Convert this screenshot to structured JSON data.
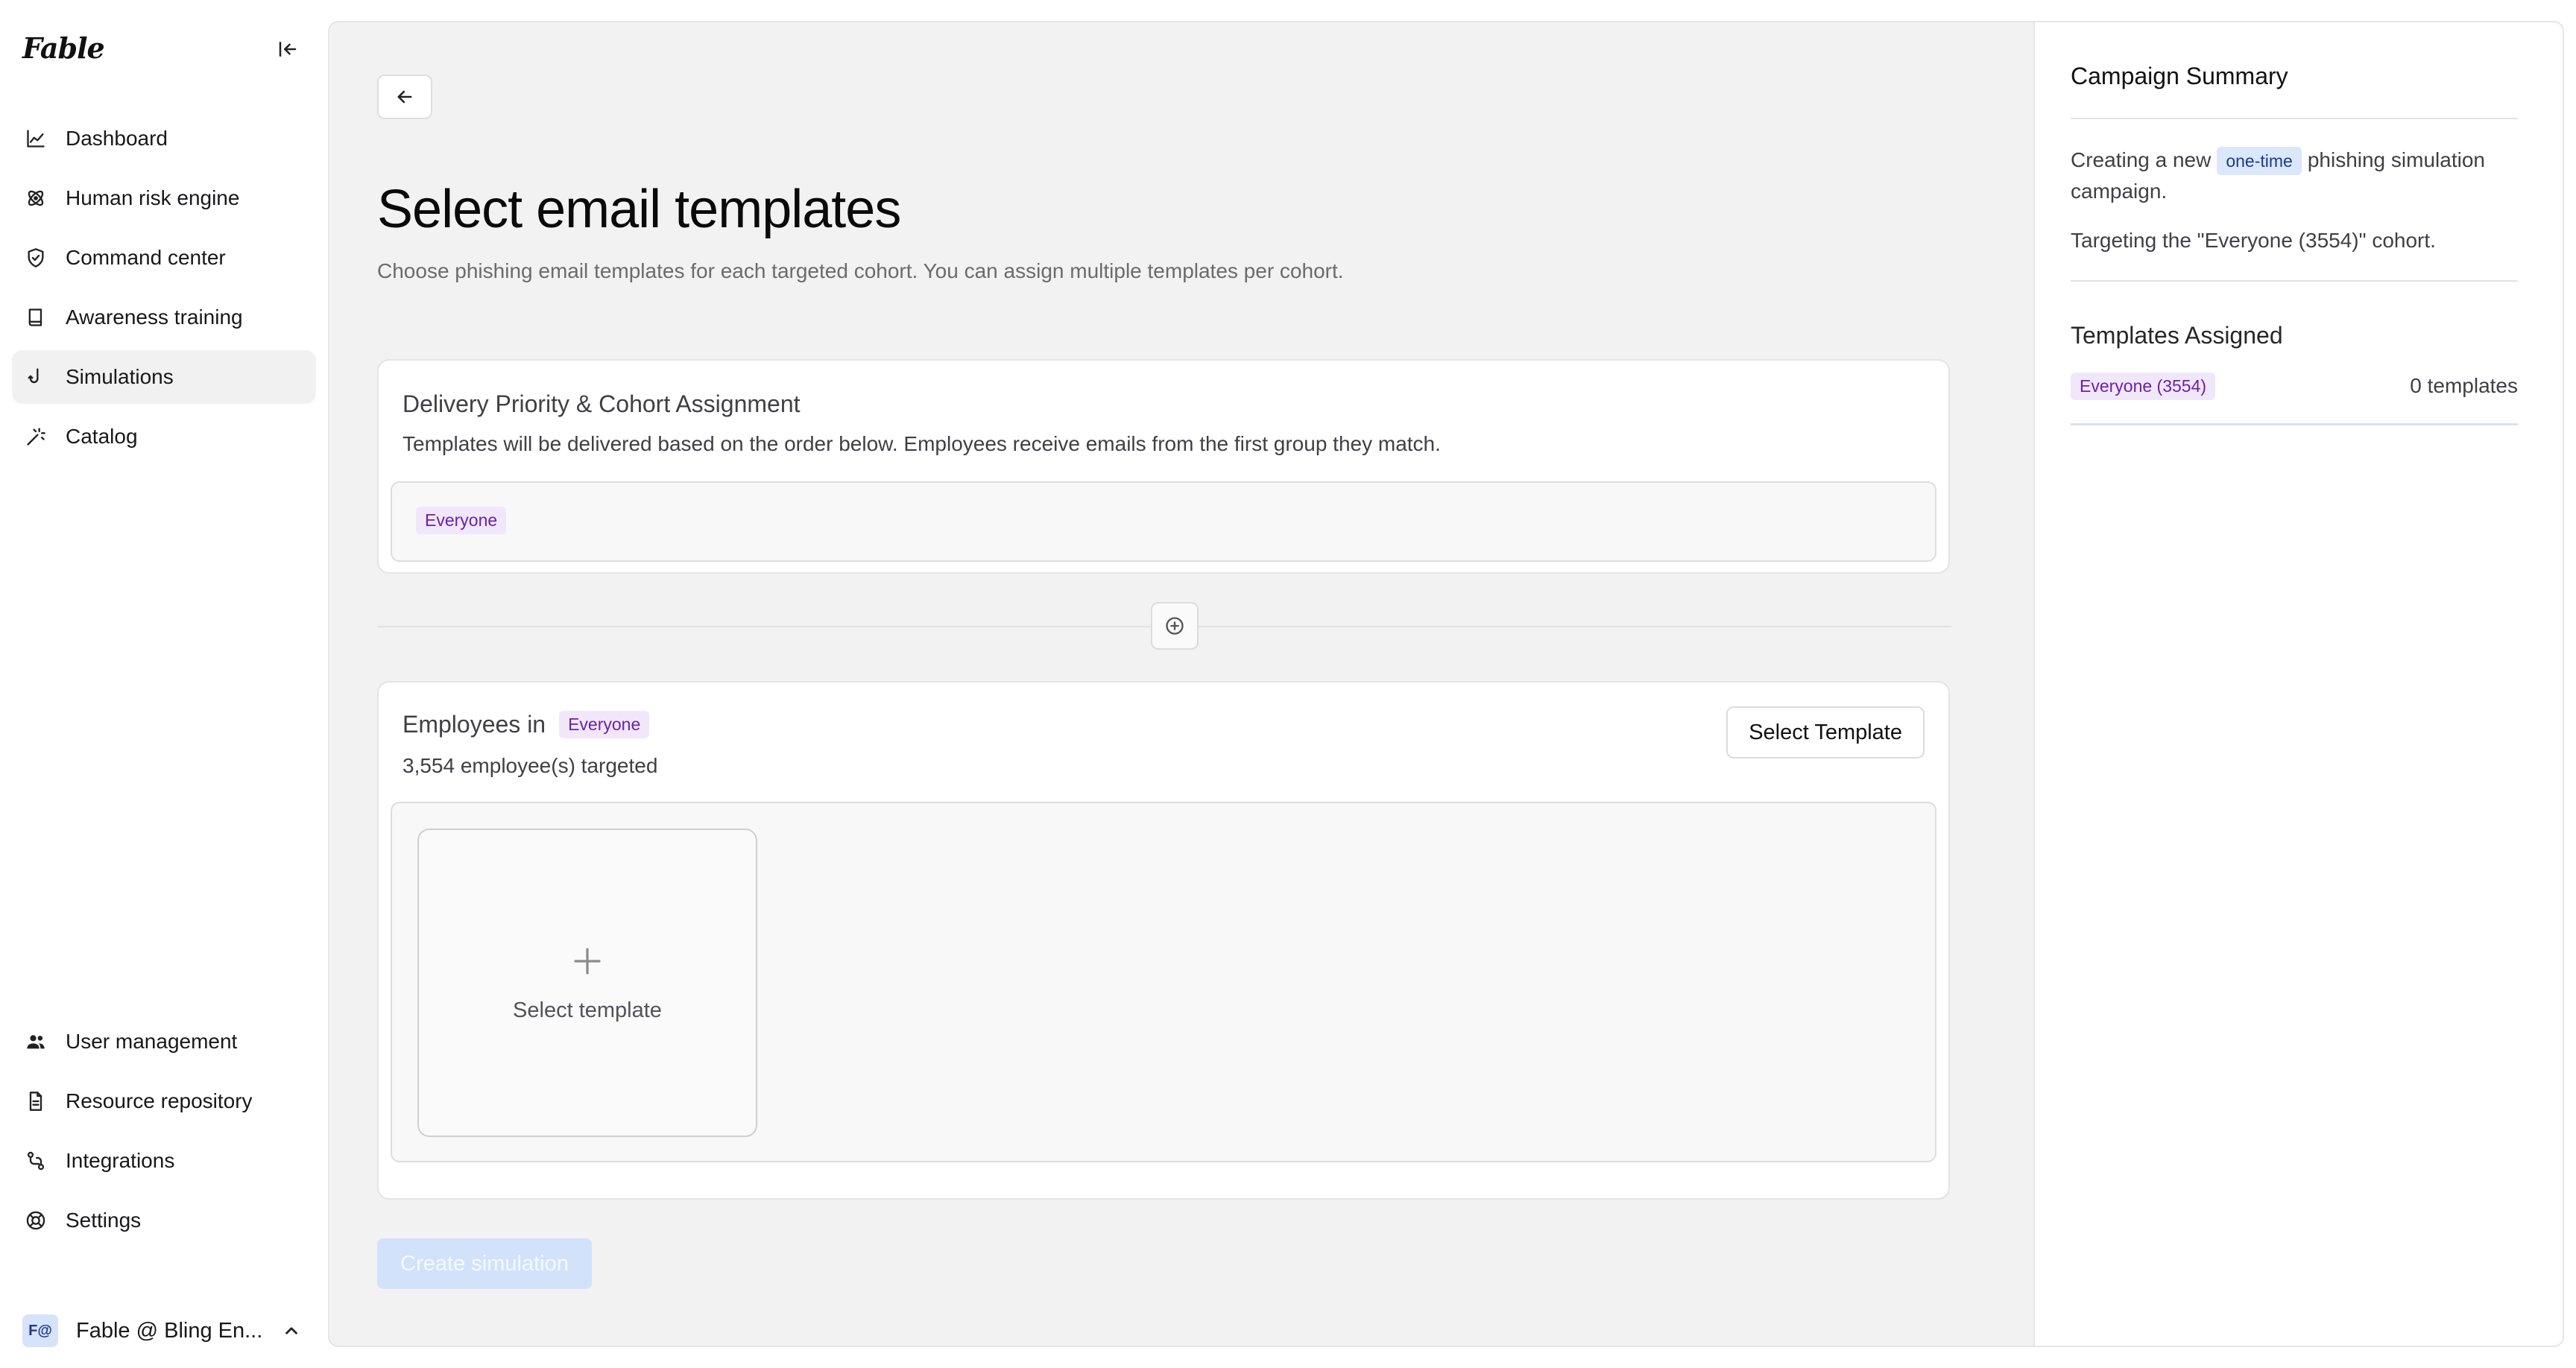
{
  "sidebar": {
    "logo": "Fable",
    "nav": [
      {
        "label": "Dashboard",
        "icon": "chart-line-icon"
      },
      {
        "label": "Human risk engine",
        "icon": "atom-icon"
      },
      {
        "label": "Command center",
        "icon": "shield-check-icon"
      },
      {
        "label": "Awareness training",
        "icon": "book-icon"
      },
      {
        "label": "Simulations",
        "icon": "hook-icon",
        "active": true
      },
      {
        "label": "Catalog",
        "icon": "magic-wand-icon"
      }
    ],
    "nav_bottom": [
      {
        "label": "User management",
        "icon": "users-icon"
      },
      {
        "label": "Resource repository",
        "icon": "document-icon"
      },
      {
        "label": "Integrations",
        "icon": "git-branch-icon"
      },
      {
        "label": "Settings",
        "icon": "lifebuoy-icon"
      }
    ],
    "org": {
      "avatar": "F@",
      "name": "Fable @ Bling En..."
    }
  },
  "page": {
    "title": "Select email templates",
    "subtitle": "Choose phishing email templates for each targeted cohort. You can assign multiple templates per cohort."
  },
  "delivery": {
    "title": "Delivery Priority & Cohort Assignment",
    "description": "Templates will be delivered based on the order below. Employees receive emails from the first group they match.",
    "cohort_badge": "Everyone"
  },
  "cohort_card": {
    "label": "Employees in",
    "badge": "Everyone",
    "count_text": "3,554 employee(s) targeted",
    "select_button": "Select Template",
    "tile_label": "Select template"
  },
  "actions": {
    "create_button": "Create simulation"
  },
  "summary": {
    "title": "Campaign Summary",
    "creating_prefix": "Creating a new",
    "campaign_type": "one-time",
    "creating_suffix": "phishing simulation campaign.",
    "targeting": "Targeting the \"Everyone (3554)\" cohort.",
    "assigned_title": "Templates Assigned",
    "assigned_badge": "Everyone (3554)",
    "assigned_count": "0 templates"
  },
  "colors": {
    "accent_disabled": "#d3e2fb",
    "badge_purple_bg": "#f1e7fb",
    "badge_purple_fg": "#6b21a8",
    "badge_blue_bg": "#dbe7fb"
  }
}
